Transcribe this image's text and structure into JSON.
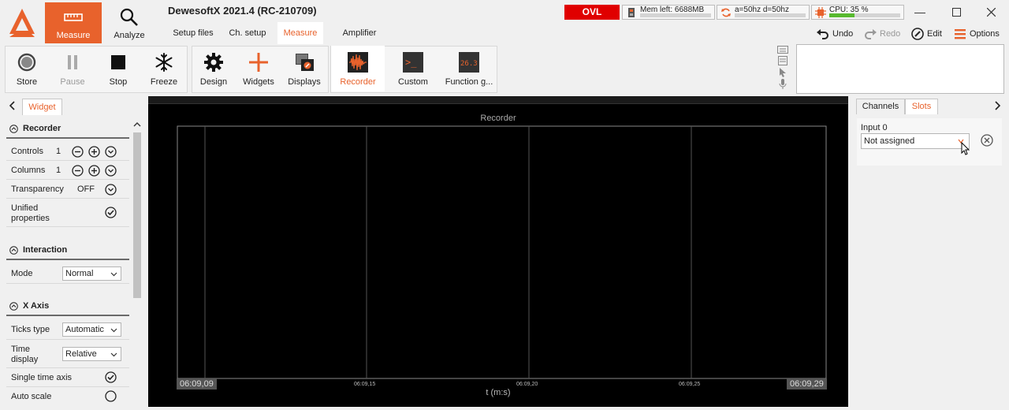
{
  "app": {
    "title": "DewesoftX 2021.4 (RC-210709)"
  },
  "modes": [
    {
      "label": "Measure",
      "icon": "ruler-icon",
      "active": true
    },
    {
      "label": "Analyze",
      "icon": "magnifier-icon",
      "active": false
    }
  ],
  "subtabs": [
    "Setup files",
    "Ch. setup",
    "Measure",
    "Amplifier"
  ],
  "status": {
    "ovl": "OVL",
    "memory": "Mem left: 6688MB",
    "sync": "a=50hz d=50hz",
    "cpu": "CPU: 35 %",
    "cpu_level": 0.35
  },
  "actions": {
    "undo": "Undo",
    "redo": "Redo",
    "edit": "Edit",
    "options": "Options"
  },
  "toolbar": {
    "store": "Store",
    "pause": "Pause",
    "stop": "Stop",
    "freeze": "Freeze",
    "design": "Design",
    "widgets": "Widgets",
    "displays": "Displays",
    "recorder": "Recorder",
    "custom": "Custom",
    "custom_glyph": ">_",
    "function": "Function g...",
    "function_glyph": "26.3"
  },
  "left": {
    "tab": "Widget",
    "recorder": {
      "header": "Recorder",
      "controls_label": "Controls",
      "controls_value": "1",
      "columns_label": "Columns",
      "columns_value": "1",
      "transparency_label": "Transparency",
      "transparency_value": "OFF",
      "unified_label_1": "Unified",
      "unified_label_2": "properties"
    },
    "interaction": {
      "header": "Interaction",
      "mode_label": "Mode",
      "mode_value": "Normal"
    },
    "xaxis": {
      "header": "X Axis",
      "ticks_label": "Ticks type",
      "ticks_value": "Automatic",
      "time_label_1": "Time",
      "time_label_2": "display",
      "time_value": "Relative",
      "single_label": "Single time axis",
      "auto_label": "Auto scale"
    }
  },
  "display": {
    "title": "Recorder",
    "xlabel": "t (m:s)",
    "start_time": "06:09,09",
    "end_time": "06:09,29",
    "ticks": [
      "06:09,15",
      "06:09,20",
      "06:09,25"
    ]
  },
  "right": {
    "tabs": [
      "Channels",
      "Slots"
    ],
    "slot_label": "Input 0",
    "slot_value": "Not assigned"
  },
  "colors": {
    "accent": "#e8622c",
    "ovl": "#e00000",
    "cpu_bar": "#57b92f"
  }
}
